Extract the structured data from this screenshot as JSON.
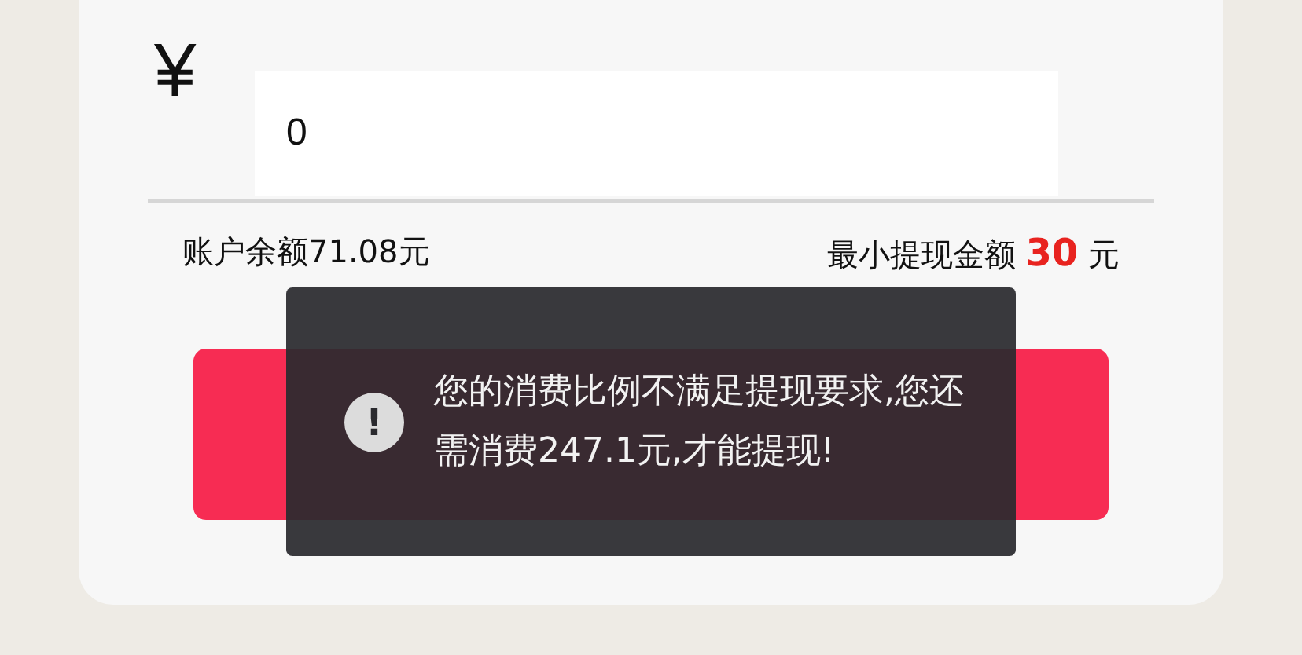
{
  "amount": {
    "currency": "¥",
    "value": "0"
  },
  "balance": "账户余额71.08元",
  "minimum": {
    "label": "最小提现金额",
    "amount": "30",
    "unit": "元"
  },
  "toast": {
    "message": "您的消费比例不满足提现要求,您还需消费247.1元,才能提现!",
    "icon": "!"
  }
}
